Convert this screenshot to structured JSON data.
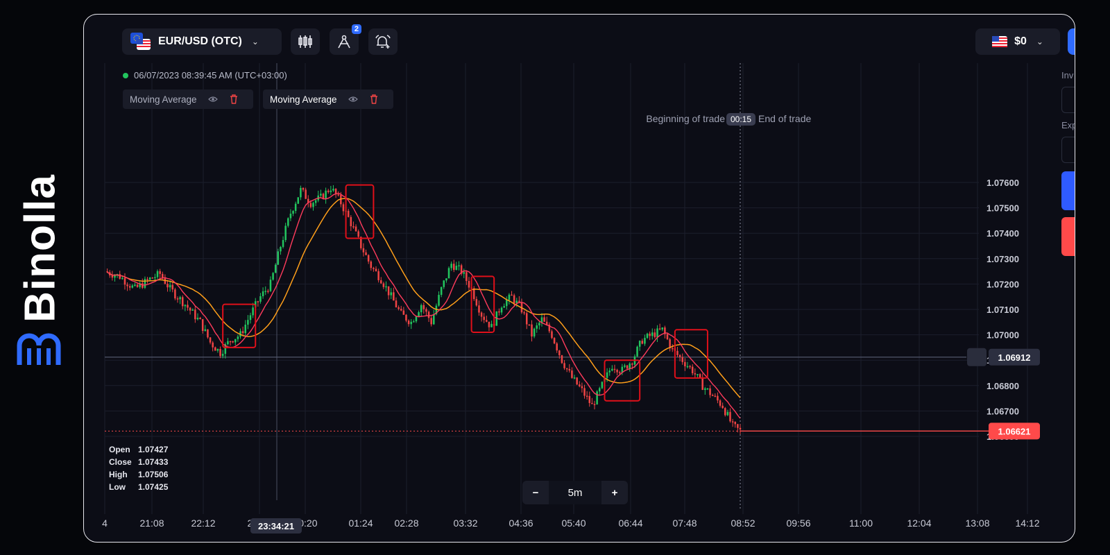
{
  "brand": {
    "name": "Binolla",
    "logo_icon": "binolla-logo-icon",
    "accent": "#2f6bff"
  },
  "toolbar": {
    "pair": "EUR/USD (OTC)",
    "pair_icon": "eu-us-flag-icon",
    "buttons": [
      {
        "name": "candles-icon"
      },
      {
        "name": "drawing-tools-icon",
        "badge": "2"
      },
      {
        "name": "add-alert-icon"
      }
    ],
    "balance": "$0",
    "balance_flag": "us-flag-icon"
  },
  "header": {
    "datetime": "06/07/2023",
    "time": "08:39:45 AM",
    "timezone": "(UTC+03:00)"
  },
  "indicators": [
    {
      "label": "Moving Average",
      "color": "#ff9f1a"
    },
    {
      "label": "Moving Average",
      "color": "#ff3b5c"
    }
  ],
  "trade_markers": {
    "begin_label": "Beginning of trade",
    "timer": "00:15",
    "end_label": "End of trade"
  },
  "ohlc": {
    "open_label": "Open",
    "open": "1.07427",
    "close_label": "Close",
    "close": "1.07433",
    "high_label": "High",
    "high": "1.07506",
    "low_label": "Low",
    "low": "1.07425"
  },
  "timeframe": {
    "minus": "−",
    "value": "5m",
    "plus": "+"
  },
  "side_panel": {
    "invest_fragment": "Inv",
    "expiry_fragment": "Exp",
    "up_color": "#2f5bff",
    "down_color": "#ff4a4a"
  },
  "chart_data": {
    "type": "candlestick",
    "symbol": "EUR/USD (OTC)",
    "timeframe": "5m",
    "y_ticks": [
      "1.07600",
      "1.07500",
      "1.07400",
      "1.07300",
      "1.07200",
      "1.07100",
      "1.07000",
      "1.06900",
      "1.06800",
      "1.06700",
      "1.06600"
    ],
    "ylim": [
      1.0657,
      1.0787
    ],
    "x_ticks": [
      "4",
      "21:08",
      "22:12",
      "23:16",
      "00:20",
      "01:24",
      "02:28",
      "03:32",
      "04:36",
      "05:40",
      "06:44",
      "07:48",
      "08:52",
      "09:56",
      "11:00",
      "12:04",
      "13:08",
      "14:12"
    ],
    "crosshair_time": "23:34:21",
    "price_line": {
      "label": "1.06912",
      "value": 1.06912
    },
    "current_price": {
      "label": "1.06621",
      "value": 1.06621,
      "color": "#ff4a4a"
    },
    "up_color": "#22c55e",
    "down_color": "#ef4444",
    "ma_fast_color": "#ff3b5c",
    "ma_slow_color": "#ff9f1a",
    "close_path": [
      [
        0,
        1.0725
      ],
      [
        6,
        1.0723
      ],
      [
        12,
        1.0718
      ],
      [
        18,
        1.0722
      ],
      [
        22,
        1.0724
      ],
      [
        26,
        1.0718
      ],
      [
        32,
        1.0712
      ],
      [
        38,
        1.0705
      ],
      [
        42,
        1.0697
      ],
      [
        46,
        1.0693
      ],
      [
        50,
        1.0698
      ],
      [
        54,
        1.07
      ],
      [
        58,
        1.0708
      ],
      [
        62,
        1.0715
      ],
      [
        66,
        1.072
      ],
      [
        70,
        1.0735
      ],
      [
        74,
        1.0748
      ],
      [
        78,
        1.0757
      ],
      [
        82,
        1.0752
      ],
      [
        86,
        1.0754
      ],
      [
        90,
        1.0758
      ],
      [
        94,
        1.0752
      ],
      [
        98,
        1.0744
      ],
      [
        102,
        1.0735
      ],
      [
        106,
        1.0727
      ],
      [
        110,
        1.0722
      ],
      [
        114,
        1.0715
      ],
      [
        118,
        1.0708
      ],
      [
        122,
        1.0705
      ],
      [
        126,
        1.0712
      ],
      [
        130,
        1.0705
      ],
      [
        134,
        1.0718
      ],
      [
        138,
        1.0728
      ],
      [
        142,
        1.0725
      ],
      [
        146,
        1.0718
      ],
      [
        150,
        1.0708
      ],
      [
        154,
        1.0703
      ],
      [
        158,
        1.0712
      ],
      [
        162,
        1.0715
      ],
      [
        166,
        1.071
      ],
      [
        170,
        1.07
      ],
      [
        174,
        1.0706
      ],
      [
        178,
        1.07
      ],
      [
        182,
        1.069
      ],
      [
        186,
        1.0683
      ],
      [
        190,
        1.0678
      ],
      [
        194,
        1.0672
      ],
      [
        198,
        1.068
      ],
      [
        202,
        1.0688
      ],
      [
        206,
        1.0686
      ],
      [
        210,
        1.069
      ],
      [
        214,
        1.0698
      ],
      [
        218,
        1.07
      ],
      [
        222,
        1.0702
      ],
      [
        226,
        1.0694
      ],
      [
        230,
        1.069
      ],
      [
        234,
        1.0686
      ],
      [
        238,
        1.068
      ],
      [
        242,
        1.0676
      ],
      [
        246,
        1.0672
      ],
      [
        250,
        1.0664
      ],
      [
        253,
        1.06621
      ]
    ],
    "highlight_boxes": [
      {
        "t0": 47,
        "t1": 60,
        "p_top": 1.0712,
        "p_bot": 1.0695
      },
      {
        "t0": 96,
        "t1": 107,
        "p_top": 1.0759,
        "p_bot": 1.0738
      },
      {
        "t0": 146,
        "t1": 155,
        "p_top": 1.0723,
        "p_bot": 1.0701
      },
      {
        "t0": 199,
        "t1": 213,
        "p_top": 1.069,
        "p_bot": 1.0674
      },
      {
        "t0": 227,
        "t1": 240,
        "p_top": 1.0702,
        "p_bot": 1.0683
      }
    ]
  }
}
